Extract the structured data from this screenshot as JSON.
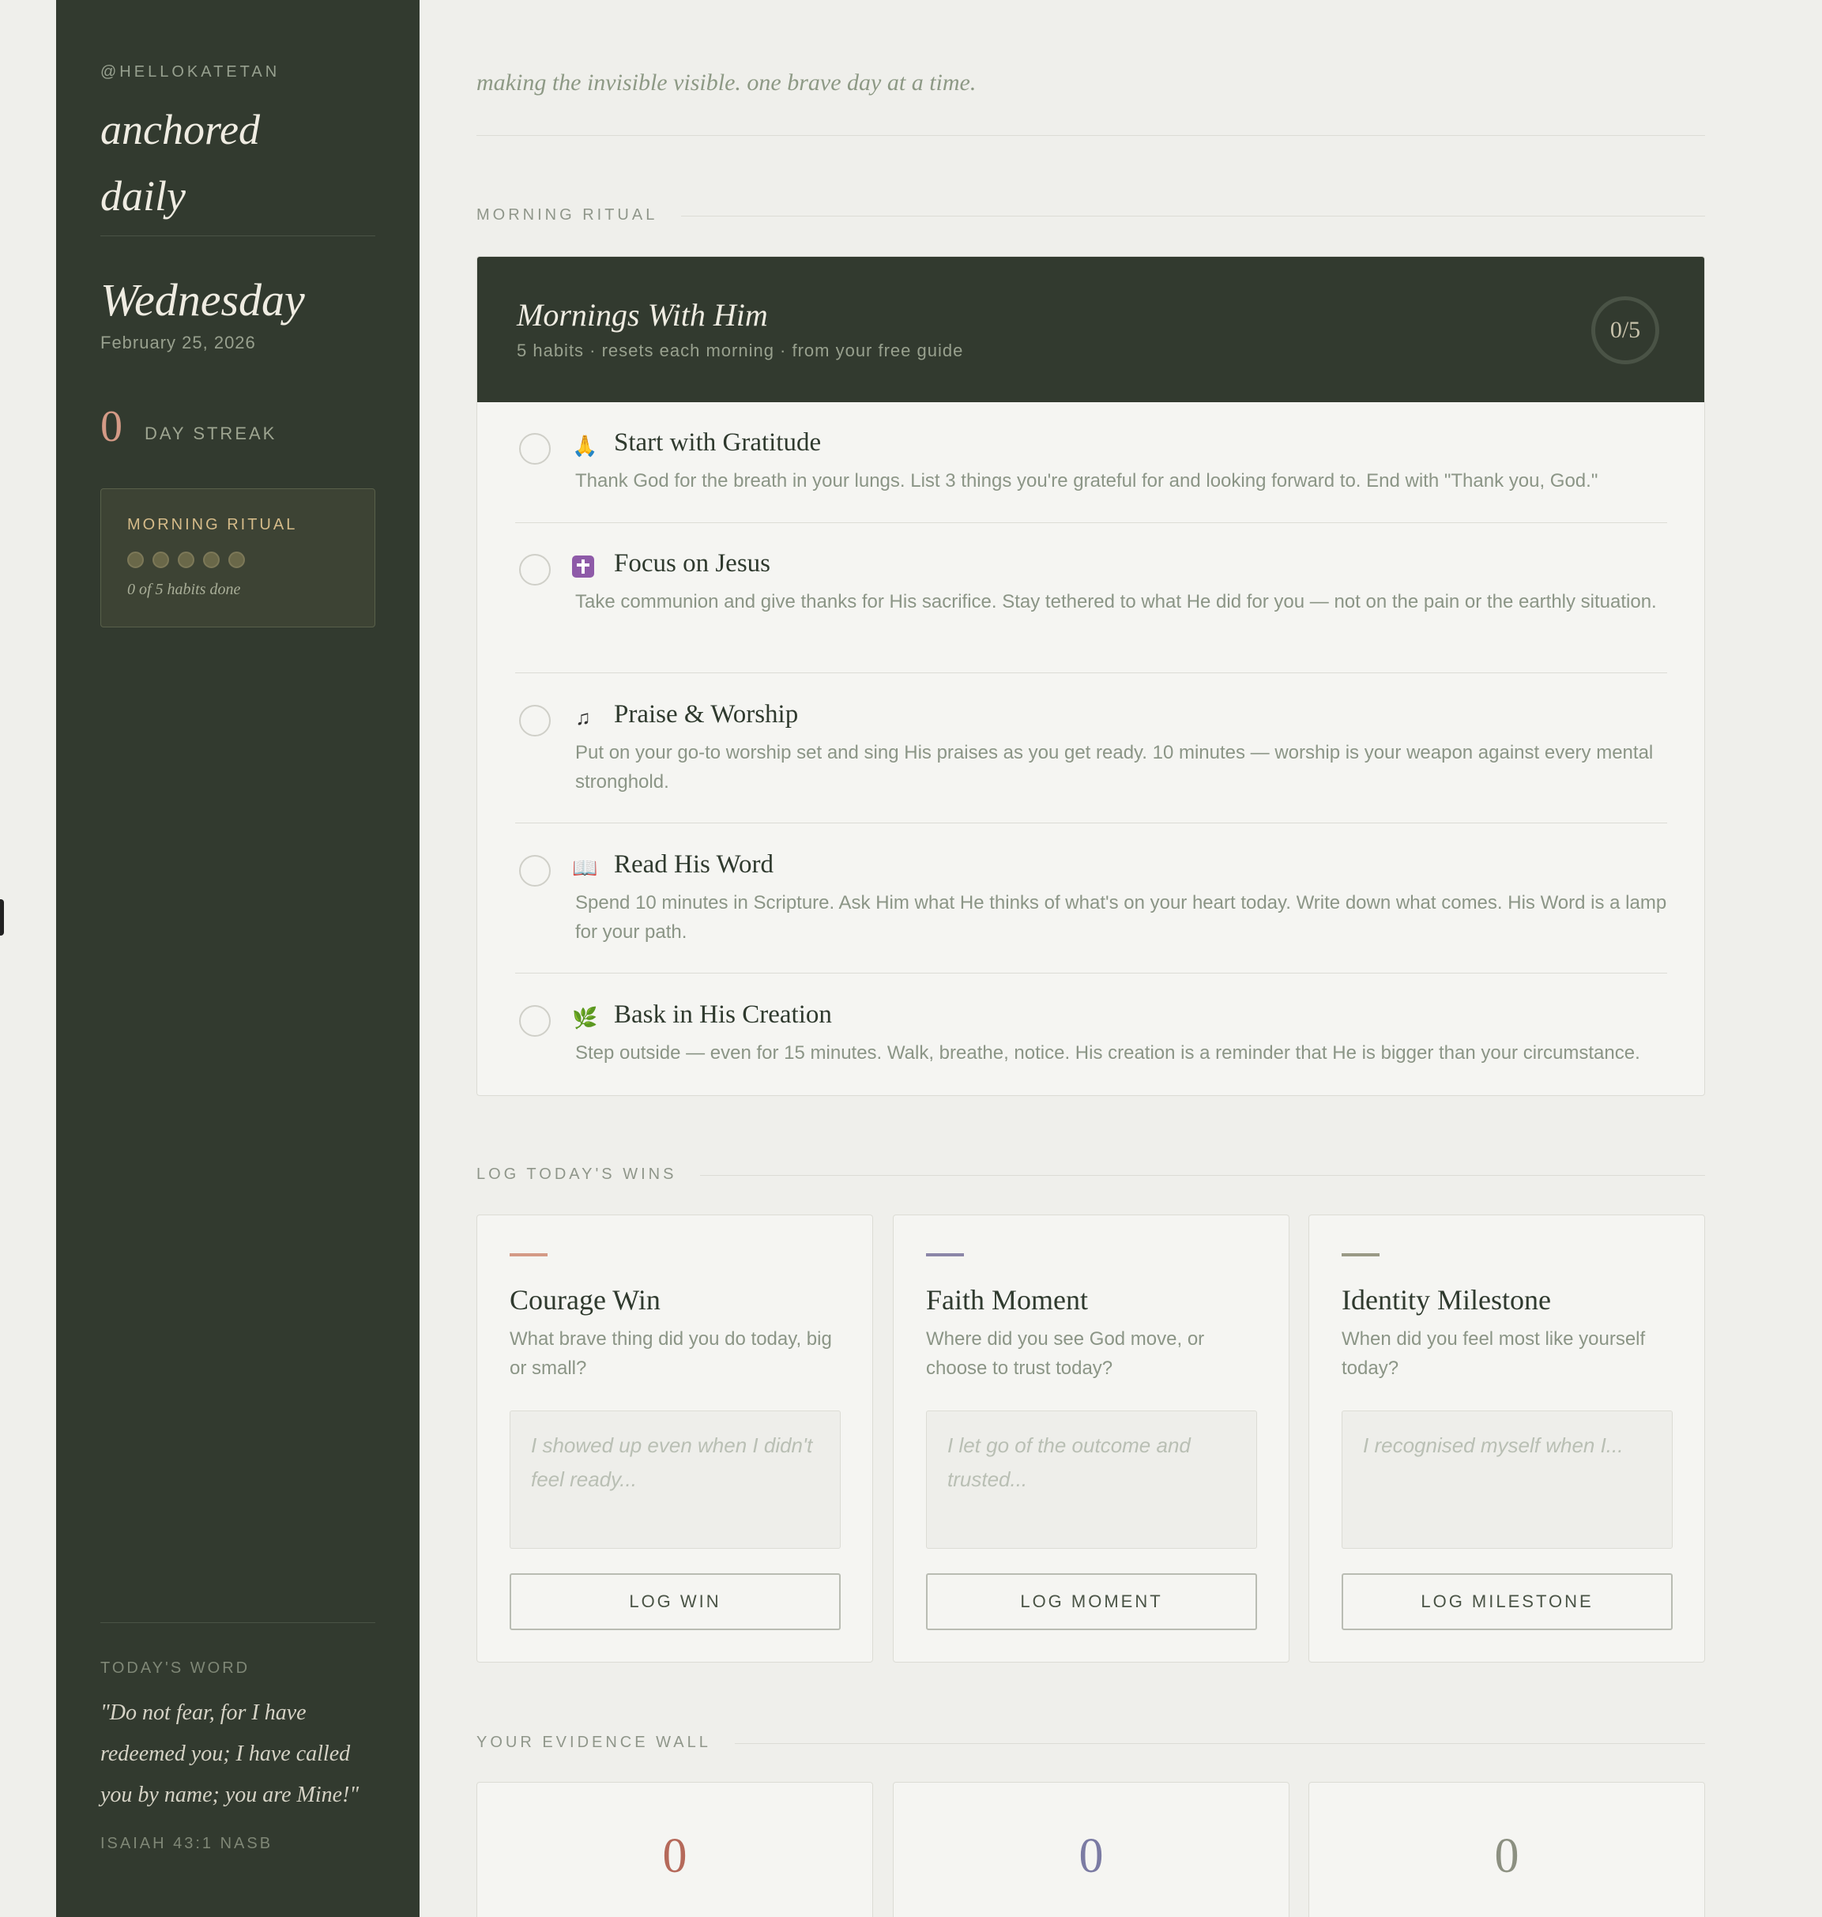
{
  "sidebar": {
    "handle": "@HELLOKATETAN",
    "brand": "anchored daily",
    "weekday": "Wednesday",
    "date": "February 25, 2026",
    "streak_count": "0",
    "streak_label": "DAY STREAK",
    "ritual_box": {
      "title": "MORNING RITUAL",
      "completed": 0,
      "total": 5,
      "summary": "0 of 5 habits done"
    },
    "todays_word": {
      "label": "TODAY'S WORD",
      "quote": "\"Do not fear, for I have redeemed you; I have called you by name; you are Mine!\"",
      "reference": "ISAIAH 43:1 NASB"
    }
  },
  "main": {
    "tagline": "making the invisible visible. one brave day at a time.",
    "morning_section_label": "MORNING RITUAL",
    "ritual": {
      "title": "Mornings With Him",
      "subtitle": "5 habits · resets each morning · from your free guide",
      "progress": "0/5",
      "habits": [
        {
          "icon": "praying-hands-icon",
          "glyph": "🙏",
          "name": "Start with Gratitude",
          "desc": "Thank God for the breath in your lungs. List 3 things you're grateful for and looking forward to. End with \"Thank you, God.\""
        },
        {
          "icon": "cross-icon",
          "glyph": "",
          "name": "Focus on Jesus",
          "desc": "Take communion and give thanks for His sacrifice. Stay tethered to what He did for you — not on the pain or the earthly situation."
        },
        {
          "icon": "music-note-icon",
          "glyph": "♫",
          "name": "Praise & Worship",
          "desc": "Put on your go-to worship set and sing His praises as you get ready. 10 minutes — worship is your weapon against every mental stronghold."
        },
        {
          "icon": "open-book-icon",
          "glyph": "📖",
          "name": "Read His Word",
          "desc": "Spend 10 minutes in Scripture. Ask Him what He thinks of what's on your heart today. Write down what comes. His Word is a lamp for your path."
        },
        {
          "icon": "herb-icon",
          "glyph": "🌿",
          "name": "Bask in His Creation",
          "desc": "Step outside — even for 15 minutes. Walk, breathe, notice. His creation is a reminder that He is bigger than your circumstance."
        }
      ]
    },
    "wins_section_label": "LOG TODAY'S WINS",
    "wins": [
      {
        "title": "Courage Win",
        "prompt": "What brave thing did you do today, big or small?",
        "placeholder": "I showed up even when I didn't feel ready...",
        "button": "LOG WIN",
        "accent": "#d49a86"
      },
      {
        "title": "Faith Moment",
        "prompt": "Where did you see God move, or choose to trust today?",
        "placeholder": "I let go of the outcome and trusted...",
        "button": "LOG MOMENT",
        "accent": "#8b86a8"
      },
      {
        "title": "Identity Milestone",
        "prompt": "When did you feel most like yourself today?",
        "placeholder": "I recognised myself when I...",
        "button": "LOG MILESTONE",
        "accent": "#9a9a86"
      }
    ],
    "evidence_section_label": "YOUR EVIDENCE WALL",
    "evidence": [
      {
        "count": "0",
        "color": "#b5695a"
      },
      {
        "count": "0",
        "color": "#7b7ba3"
      },
      {
        "count": "0",
        "color": "#8c9081"
      }
    ]
  }
}
